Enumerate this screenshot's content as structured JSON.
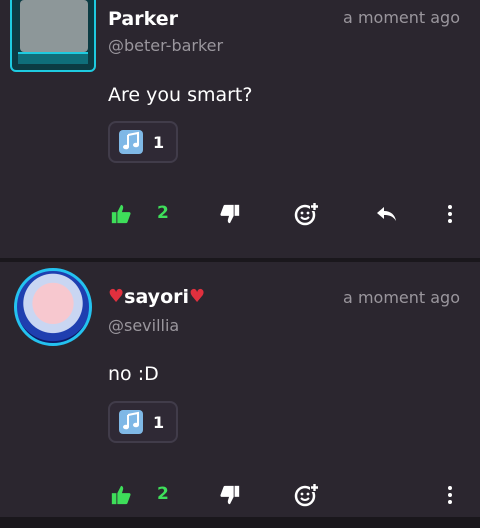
{
  "posts": [
    {
      "username": "Parker",
      "handle": "@beter-barker",
      "timestamp": "a moment ago",
      "content": "Are you smart?",
      "reaction": {
        "emoji": "music-notes",
        "count": "1"
      },
      "likes": "2"
    },
    {
      "username": "sayori",
      "username_decoration": "♥",
      "handle": "@sevillia",
      "timestamp": "a moment ago",
      "content": "no :D",
      "reaction": {
        "emoji": "music-notes",
        "count": "1"
      },
      "likes": "2"
    }
  ],
  "colors": {
    "background": "#1e1b21",
    "card": "#2b262f",
    "like_green": "#3ede5a",
    "muted_text": "#9a969d",
    "heart": "#e0303e"
  },
  "icons": [
    "thumbs-up-icon",
    "thumbs-down-icon",
    "add-reaction-icon",
    "reply-icon",
    "more-options-icon"
  ]
}
